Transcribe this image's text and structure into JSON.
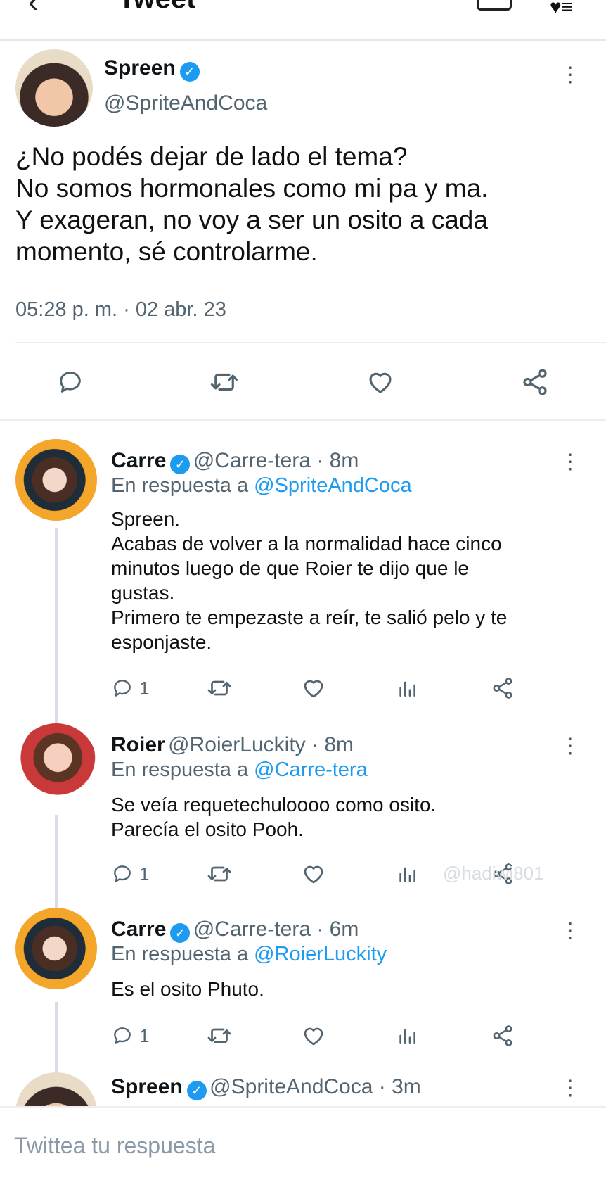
{
  "header": {
    "back_icon": "back-arrow-icon",
    "title": "Tweet"
  },
  "main_tweet": {
    "name": "Spreen",
    "handle": "@SpriteAndCoca",
    "lines": [
      "¿No podés dejar de lado el tema?",
      "No somos hormonales como mi pa y ma.",
      "Y exageran, no voy a ser un osito a cada",
      "momento, sé controlarme."
    ],
    "timestamp": "05:28 p. m. · 02 abr. 23"
  },
  "replies": [
    {
      "name": "Carre",
      "handle": "@Carre-tera · 8m",
      "reply_to_prefix": "En respuesta a ",
      "reply_to": "@SpriteAndCoca",
      "lines": [
        "Spreen.",
        "Acabas de volver a la normalidad hace cinco",
        "minutos luego de que Roier te dijo que le",
        "gustas.",
        "Primero te empezaste a reír, te salió pelo y te",
        "esponjaste."
      ],
      "reply_count": "1"
    },
    {
      "name": "Roier",
      "handle": "@RoierLuckity · 8m",
      "reply_to_prefix": "En respuesta a ",
      "reply_to": "@Carre-tera",
      "lines": [
        "Se veía requetechuloooo como osito.",
        "Parecía el osito Pooh."
      ],
      "reply_count": "1"
    },
    {
      "name": "Carre",
      "handle": "@Carre-tera · 6m",
      "reply_to_prefix": "En respuesta a ",
      "reply_to": "@RoierLuckity",
      "lines": [
        "Es el osito Phuto."
      ],
      "reply_count": "1"
    },
    {
      "name": "Spreen",
      "handle": "@SpriteAndCoca · 3m"
    }
  ],
  "watermark": "@hadiwi801",
  "compose": {
    "placeholder": "Twittea tu respuesta"
  },
  "colors": {
    "accent": "#1d9bf0",
    "secondary_text": "#536471",
    "icon_gray": "#536471"
  }
}
